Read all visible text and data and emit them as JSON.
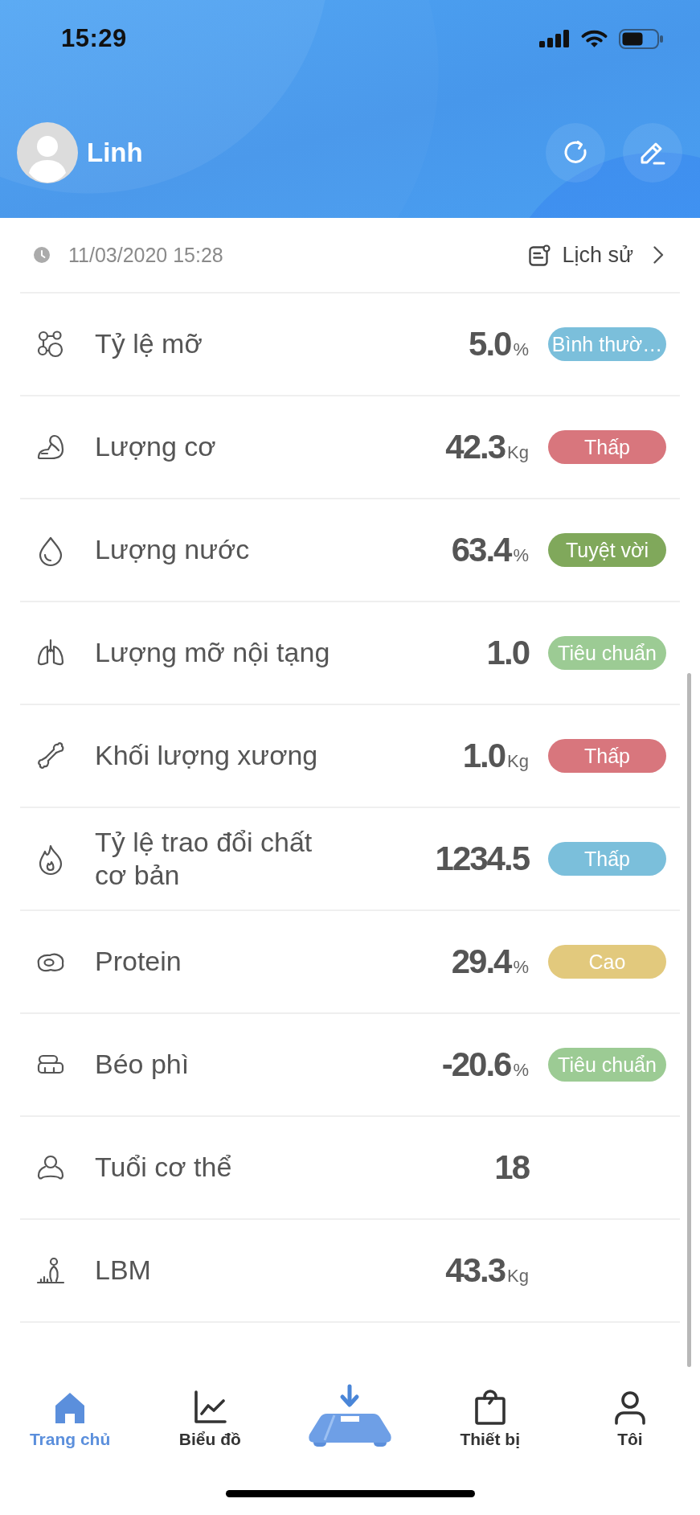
{
  "status_bar": {
    "time": "15:29"
  },
  "header": {
    "user_name": "Linh"
  },
  "measurement": {
    "date": "11/03/2020 15:28",
    "history_link": "Lịch sử"
  },
  "metrics": [
    {
      "label": "Tỷ lệ mỡ",
      "value": "5.0",
      "unit": "%",
      "status": {
        "text": "Bình thườ…",
        "color": "#7bbfdb"
      }
    },
    {
      "label": "Lượng cơ",
      "value": "42.3",
      "unit": "Kg",
      "status": {
        "text": "Thấp",
        "color": "#d8767d"
      }
    },
    {
      "label": "Lượng nước",
      "value": "63.4",
      "unit": "%",
      "status": {
        "text": "Tuyệt vời",
        "color": "#80a85b"
      }
    },
    {
      "label": "Lượng mỡ nội tạng",
      "value": "1.0",
      "status": {
        "text": "Tiêu chuẩn",
        "color": "#9ccb94"
      }
    },
    {
      "label": "Khối lượng xương",
      "value": "1.0",
      "unit": "Kg",
      "status": {
        "text": "Thấp",
        "color": "#d8767d"
      }
    },
    {
      "label": "Tỷ lệ trao đổi chất cơ bản",
      "value": "1234.5",
      "status": {
        "text": "Thấp",
        "color": "#7bbfdb"
      }
    },
    {
      "label": "Protein",
      "value": "29.4",
      "unit": "%",
      "status": {
        "text": "Cao",
        "color": "#e2c97d"
      }
    },
    {
      "label": "Béo phì",
      "value": "-20.6",
      "unit": "%",
      "status": {
        "text": "Tiêu chuẩn",
        "color": "#9ccb94"
      }
    },
    {
      "label": "Tuổi cơ thể",
      "value": "18"
    },
    {
      "label": "LBM",
      "value": "43.3",
      "unit": "Kg"
    }
  ],
  "bottom_nav": {
    "tabs": [
      {
        "kind": "tab",
        "label": "Trang chủ",
        "selected": true
      },
      {
        "kind": "tab",
        "label": "Biểu đồ",
        "selected": false
      },
      {
        "kind": "measure",
        "selected": false
      },
      {
        "kind": "tab",
        "label": "Thiết bị",
        "selected": false
      },
      {
        "kind": "tab",
        "label": "Tôi",
        "selected": false
      }
    ]
  }
}
